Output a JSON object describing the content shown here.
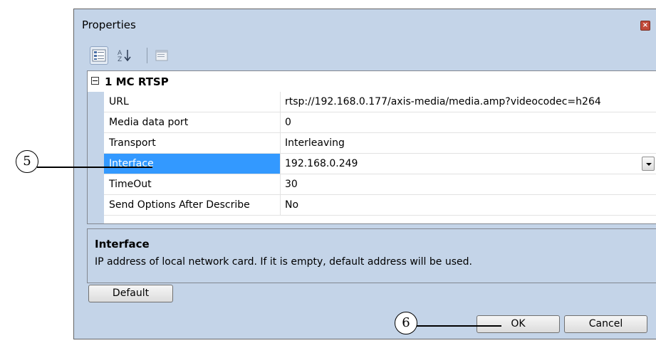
{
  "dialog": {
    "title": "Properties",
    "close_glyph": "×"
  },
  "toolbar": {
    "buttons": [
      {
        "name": "categorized-view-icon",
        "active": true
      },
      {
        "name": "alphabetical-sort-icon",
        "active": false
      },
      {
        "name": "property-pages-icon",
        "active": false
      }
    ]
  },
  "grid": {
    "category": {
      "label": "1 MC RTSP",
      "expanded": true
    },
    "rows": [
      {
        "name": "URL",
        "value": "rtsp://192.168.0.177/axis-media/media.amp?videocodec=h264"
      },
      {
        "name": "Media data port",
        "value": "0"
      },
      {
        "name": "Transport",
        "value": "Interleaving"
      },
      {
        "name": "Interface",
        "value": "192.168.0.249"
      },
      {
        "name": "TimeOut",
        "value": "30"
      },
      {
        "name": "Send Options After Describe",
        "value": "No"
      }
    ],
    "selected_index": 3
  },
  "description": {
    "title": "Interface",
    "text": "IP address of local network card. If it is empty, default address will be used."
  },
  "buttons": {
    "default_label": "Default",
    "ok_label": "OK",
    "cancel_label": "Cancel"
  },
  "callouts": {
    "interface": "5",
    "ok": "6"
  },
  "colors": {
    "dialog_bg": "#c4d4e8",
    "selection": "#3399ff"
  }
}
